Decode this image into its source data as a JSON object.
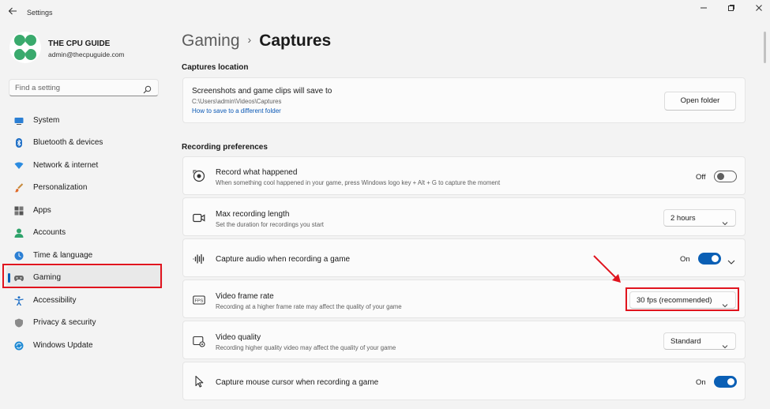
{
  "window": {
    "title": "Settings",
    "back_icon": "back-arrow-icon",
    "minimize_icon": "minimize-icon",
    "maximize_icon": "restore-icon",
    "close_icon": "close-icon"
  },
  "profile": {
    "name": "THE CPU GUIDE",
    "email": "admin@thecpuguide.com",
    "avatar_color": "#3aaa6d"
  },
  "search": {
    "placeholder": "Find a setting"
  },
  "sidebar": {
    "items": [
      {
        "label": "System",
        "icon": "system-icon",
        "active": false
      },
      {
        "label": "Bluetooth & devices",
        "icon": "bluetooth-icon",
        "active": false
      },
      {
        "label": "Network & internet",
        "icon": "wifi-icon",
        "active": false
      },
      {
        "label": "Personalization",
        "icon": "brush-icon",
        "active": false
      },
      {
        "label": "Apps",
        "icon": "apps-icon",
        "active": false
      },
      {
        "label": "Accounts",
        "icon": "accounts-icon",
        "active": false
      },
      {
        "label": "Time & language",
        "icon": "clock-globe-icon",
        "active": false
      },
      {
        "label": "Gaming",
        "icon": "gamepad-icon",
        "active": true
      },
      {
        "label": "Accessibility",
        "icon": "accessibility-icon",
        "active": false
      },
      {
        "label": "Privacy & security",
        "icon": "shield-icon",
        "active": false
      },
      {
        "label": "Windows Update",
        "icon": "update-icon",
        "active": false
      }
    ]
  },
  "breadcrumb": {
    "parent": "Gaming",
    "separator": "›",
    "current": "Captures"
  },
  "captures_location": {
    "header": "Captures location",
    "title": "Screenshots and game clips will save to",
    "path": "C:\\Users\\admin\\Videos\\Captures",
    "link": "How to save to a different folder",
    "button": "Open folder"
  },
  "recording_preferences": {
    "header": "Recording preferences",
    "record_what_happened": {
      "title": "Record what happened",
      "desc": "When something cool happened in your game, press Windows logo key + Alt + G to capture the moment",
      "toggle_label": "Off",
      "toggle_on": false
    },
    "max_length": {
      "title": "Max recording length",
      "desc": "Set the duration for recordings you start",
      "value": "2 hours"
    },
    "capture_audio": {
      "title": "Capture audio when recording a game",
      "toggle_label": "On",
      "toggle_on": true
    },
    "frame_rate": {
      "title": "Video frame rate",
      "desc": "Recording at a higher frame rate may affect the quality of your game",
      "value": "30 fps (recommended)"
    },
    "video_quality": {
      "title": "Video quality",
      "desc": "Recording higher quality video may affect the quality of your game",
      "value": "Standard"
    },
    "mouse_cursor": {
      "title": "Capture mouse cursor when recording a game",
      "toggle_label": "On",
      "toggle_on": true
    }
  },
  "colors": {
    "accent": "#0a5fb5",
    "annotation_red": "#e0141e",
    "link": "#0a58b5"
  }
}
